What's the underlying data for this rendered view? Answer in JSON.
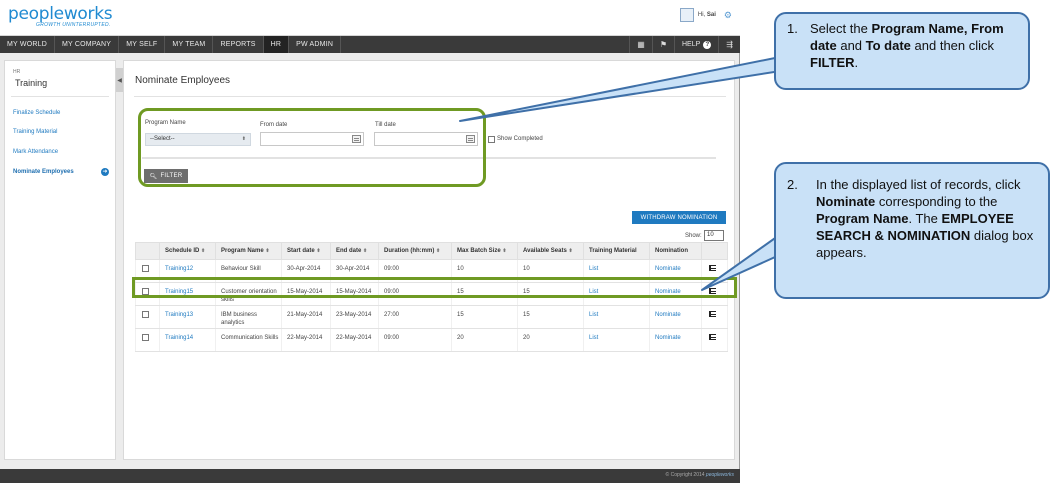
{
  "app": {
    "logo_text": "peopleworks",
    "tagline": "GROWTH UNINTERRUPTED.",
    "greeting": "Hi,",
    "user_name": "Sai"
  },
  "nav": {
    "items": [
      "MY WORLD",
      "MY COMPANY",
      "MY SELF",
      "MY TEAM",
      "REPORTS",
      "HR",
      "PW ADMIN"
    ],
    "active": "HR",
    "help_label": "HELP"
  },
  "sidebar": {
    "crumb": "HR",
    "title": "Training",
    "links": [
      "Finalize Schedule",
      "Training Material",
      "Mark Attendance",
      "Nominate Employees"
    ],
    "active": "Nominate Employees"
  },
  "page": {
    "title": "Nominate Employees"
  },
  "filters": {
    "program_label": "Program Name",
    "program_value": "--Select--",
    "from_label": "From date",
    "from_value": "",
    "till_label": "Till date",
    "till_value": "",
    "show_completed_label": "Show Completed",
    "filter_button": "FILTER"
  },
  "actions": {
    "withdraw_button": "WITHDRAW NOMINATION",
    "show_label": "Show:",
    "show_value": "10"
  },
  "table": {
    "headers": [
      "Schedule ID",
      "Program Name",
      "Start date",
      "End date",
      "Duration (hh:mm)",
      "Max Batch Size",
      "Available Seats",
      "Training Material",
      "Nomination"
    ],
    "rows": [
      {
        "id": "Training12",
        "program": "Behaviour Skill",
        "start": "30-Apr-2014",
        "end": "30-Apr-2014",
        "duration": "09:00",
        "max": "10",
        "seats": "10",
        "material": "List",
        "nomination": "Nominate"
      },
      {
        "id": "Training15",
        "program": "Customer orientation skills",
        "start": "15-May-2014",
        "end": "15-May-2014",
        "duration": "09:00",
        "max": "15",
        "seats": "15",
        "material": "List",
        "nomination": "Nominate"
      },
      {
        "id": "Training13",
        "program": "IBM business analytics",
        "start": "21-May-2014",
        "end": "23-May-2014",
        "duration": "27:00",
        "max": "15",
        "seats": "15",
        "material": "List",
        "nomination": "Nominate"
      },
      {
        "id": "Training14",
        "program": "Communication Skills",
        "start": "22-May-2014",
        "end": "22-May-2014",
        "duration": "09:00",
        "max": "20",
        "seats": "20",
        "material": "List",
        "nomination": "Nominate"
      }
    ]
  },
  "footer": {
    "copyright": "© Copyright 2014",
    "brand": "peopleworks"
  },
  "callouts": {
    "step1_num": "1.",
    "step1_text": "Select the <b>Program Name, From date</b> and <b>To date</b> and then click <b>FILTER</b>.",
    "step2_num": "2.",
    "step2_text": "In the displayed list of records, click <b>Nominate</b> corresponding to the <b>Program Name</b>. The <b>EMPLOYEE SEARCH &amp; NOMINATION</b> dialog box appears."
  },
  "colors": {
    "accent": "#1f7ac0",
    "highlight": "#6f9a23",
    "callout_fill": "#c9e1f7",
    "callout_border": "#3f70a8"
  }
}
